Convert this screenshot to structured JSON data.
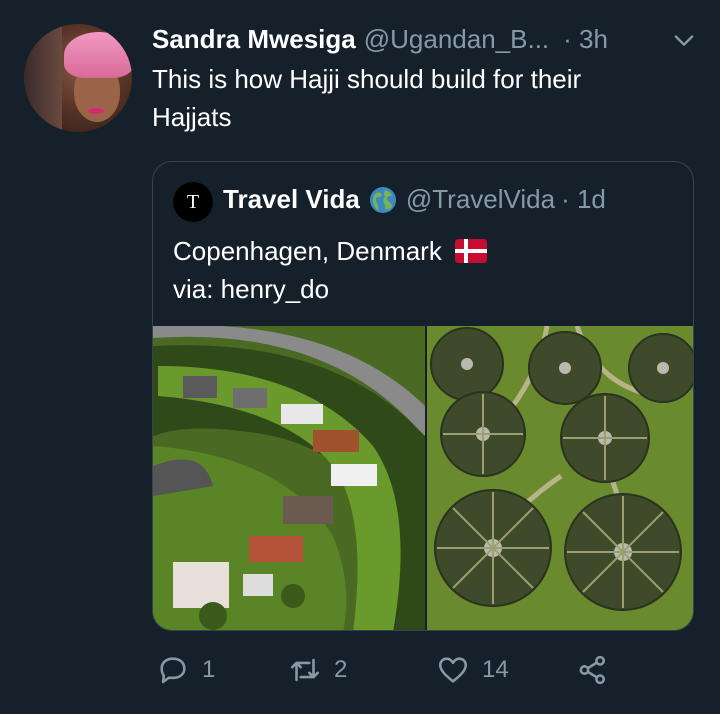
{
  "tweet": {
    "author_name": "Sandra Mwesiga",
    "author_handle": "@Ugandan_B...",
    "time": "· 3h",
    "text_line1": "This is how Hajji should build for their",
    "text_line2": "Hajjats"
  },
  "quoted_tweet": {
    "avatar_letter": "T",
    "author_name": "Travel Vida",
    "author_handle": "@TravelVida",
    "time": "· 1d",
    "text_line1": "Copenhagen, Denmark",
    "text_line2": "via: henry_do"
  },
  "actions": {
    "reply_count": "1",
    "retweet_count": "2",
    "like_count": "14"
  },
  "icons": {
    "chevron": "chevron-down-icon",
    "globe": "globe-icon",
    "flag": "denmark-flag-icon",
    "reply": "reply-icon",
    "retweet": "retweet-icon",
    "like": "heart-icon",
    "share": "share-icon"
  },
  "colors": {
    "background": "#15202b",
    "secondary_text": "#8899a6",
    "border": "#38444d"
  }
}
